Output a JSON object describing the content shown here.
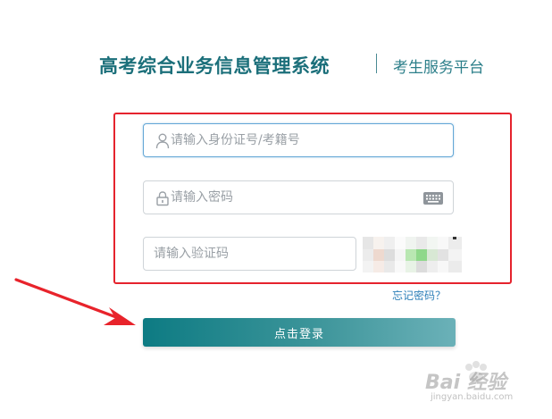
{
  "header": {
    "title": "高考综合业务信息管理系统",
    "subtitle": "考生服务平台"
  },
  "form": {
    "username": {
      "placeholder": "请输入身份证号/考籍号",
      "value": "",
      "icon": "user-icon"
    },
    "password": {
      "placeholder": "请输入密码",
      "value": "",
      "icon": "lock-icon",
      "keyboard_icon": "keyboard-icon"
    },
    "captcha": {
      "placeholder": "请输入验证码",
      "value": ""
    },
    "forgot_password": "忘记密码？",
    "login_button": "点击登录"
  },
  "watermark": {
    "text": "Bai 经验",
    "url": "jingyan.baidu.com"
  },
  "colors": {
    "brand": "#1b6f7a",
    "highlight": "#e5232d",
    "link": "#2d7fb8",
    "button_start": "#0d7b83",
    "button_end": "#6bb1b8"
  }
}
